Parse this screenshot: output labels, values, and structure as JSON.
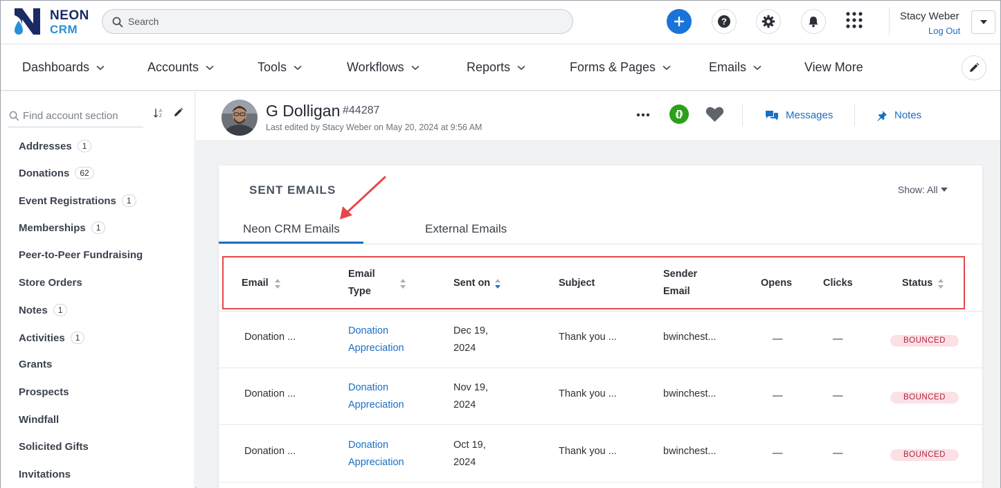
{
  "brand": {
    "line1": "NEON",
    "line2": "CRM"
  },
  "search": {
    "placeholder": "Search"
  },
  "user": {
    "name": "Stacy Weber",
    "logout": "Log Out"
  },
  "nav": {
    "items": [
      "Dashboards",
      "Accounts",
      "Tools",
      "Workflows",
      "Reports",
      "Forms & Pages",
      "Emails",
      "View More"
    ]
  },
  "sidebar": {
    "search_placeholder": "Find account section",
    "items": [
      {
        "label": "Addresses",
        "count": "1"
      },
      {
        "label": "Donations",
        "count": "62"
      },
      {
        "label": "Event Registrations",
        "count": "1"
      },
      {
        "label": "Memberships",
        "count": "1"
      },
      {
        "label": "Peer-to-Peer Fundraising",
        "count": ""
      },
      {
        "label": "Store Orders",
        "count": ""
      },
      {
        "label": "Notes",
        "count": "1"
      },
      {
        "label": "Activities",
        "count": "1"
      },
      {
        "label": "Grants",
        "count": ""
      },
      {
        "label": "Prospects",
        "count": ""
      },
      {
        "label": "Windfall",
        "count": ""
      },
      {
        "label": "Solicited Gifts",
        "count": ""
      },
      {
        "label": "Invitations",
        "count": ""
      }
    ]
  },
  "account": {
    "name": "G Dolligan",
    "id": "#44287",
    "last_edited": "Last edited by Stacy Weber on May 20, 2024 at 9:56 AM",
    "messages_label": "Messages",
    "notes_label": "Notes"
  },
  "card": {
    "title": "SENT EMAILS",
    "show_label": "Show: All",
    "tabs": [
      "Neon CRM Emails",
      "External Emails"
    ],
    "active_tab": 0,
    "columns": {
      "email": "Email",
      "email_type_1": "Email",
      "email_type_2": "Type",
      "sent_on": "Sent on",
      "subject": "Subject",
      "sender_1": "Sender",
      "sender_2": "Email",
      "opens": "Opens",
      "clicks": "Clicks",
      "status": "Status"
    },
    "rows": [
      {
        "email": "Donation ...",
        "type_1": "Donation",
        "type_2": "Appreciation",
        "date_1": "Dec 19,",
        "date_2": "2024",
        "subject": "Thank you ...",
        "sender": "bwinchest...",
        "opens": "—",
        "clicks": "—",
        "status": "BOUNCED"
      },
      {
        "email": "Donation ...",
        "type_1": "Donation",
        "type_2": "Appreciation",
        "date_1": "Nov 19,",
        "date_2": "2024",
        "subject": "Thank you ...",
        "sender": "bwinchest...",
        "opens": "—",
        "clicks": "—",
        "status": "BOUNCED"
      },
      {
        "email": "Donation ...",
        "type_1": "Donation",
        "type_2": "Appreciation",
        "date_1": "Oct 19,",
        "date_2": "2024",
        "subject": "Thank you ...",
        "sender": "bwinchest...",
        "opens": "—",
        "clicks": "—",
        "status": "BOUNCED"
      }
    ]
  },
  "colors": {
    "accent": "#1a73d9",
    "link": "#1a6fc4",
    "qb_green": "#2ca01c",
    "annotation_red": "#e5474b",
    "bounced_bg": "#fbe1e6",
    "bounced_text": "#b3243e"
  },
  "icons": [
    "search-icon",
    "plus-icon",
    "help-icon",
    "gear-icon",
    "bell-icon",
    "apps-grid-icon",
    "chevron-down-icon",
    "pencil-icon",
    "sort-az-icon",
    "more-dots-icon",
    "quickbooks-icon",
    "heart-icon",
    "messages-icon",
    "pin-icon",
    "sort-icon"
  ]
}
